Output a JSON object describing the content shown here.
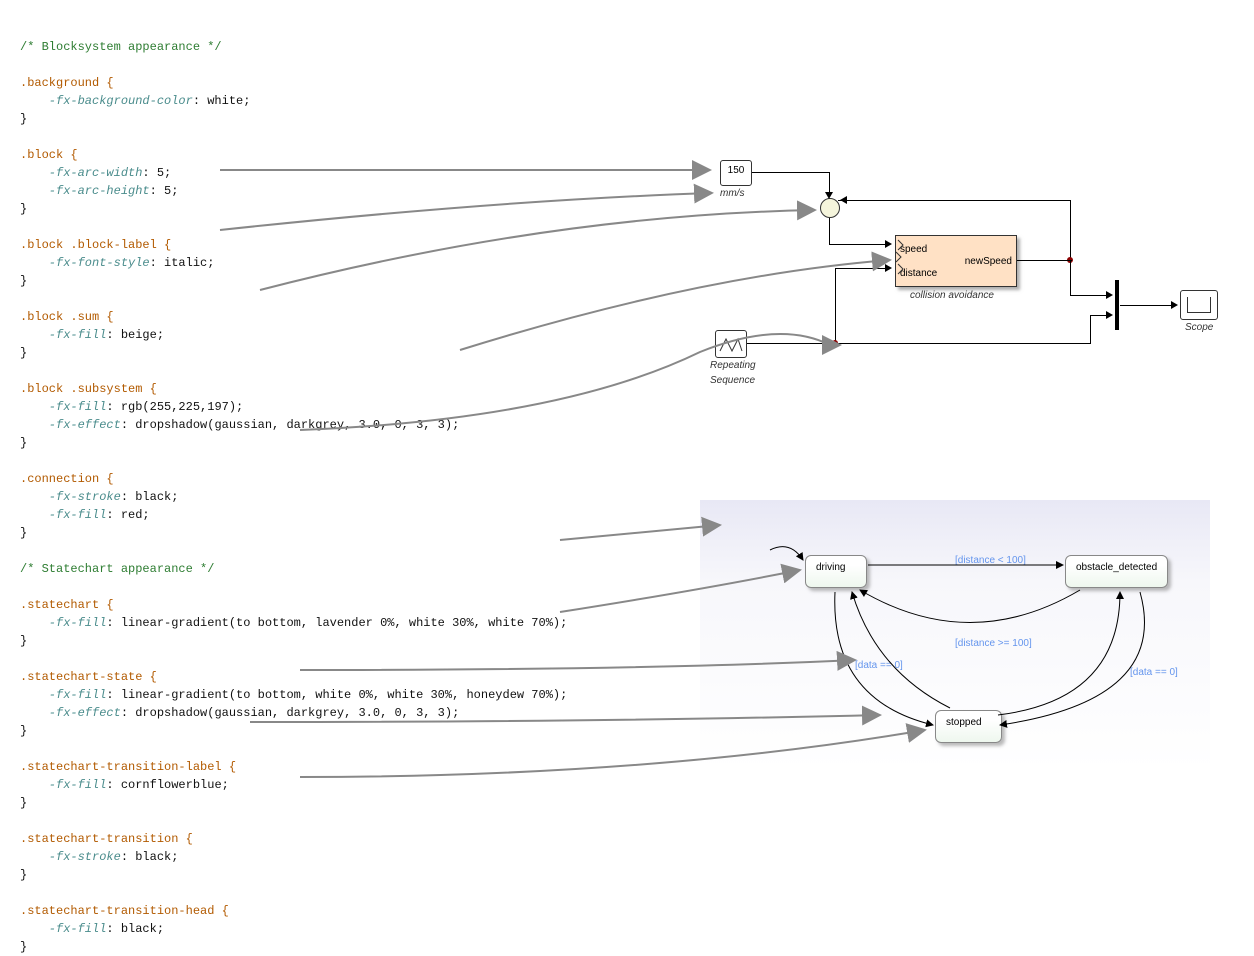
{
  "code": {
    "comment_block": "/* Blocksystem appearance */",
    "background_sel": ".background {",
    "background_p1": "    -fx-background-color",
    "background_v1": ": white;",
    "block_sel": ".block {",
    "block_p1": "    -fx-arc-width",
    "block_v1": ": 5;",
    "block_p2": "    -fx-arc-height",
    "block_v2": ": 5;",
    "blocklabel_sel": ".block .block-label {",
    "blocklabel_p1": "    -fx-font-style",
    "blocklabel_v1": ": italic;",
    "blocksum_sel": ".block .sum {",
    "blocksum_p1": "    -fx-fill",
    "blocksum_v1": ": beige;",
    "blocksub_sel": ".block .subsystem {",
    "blocksub_p1": "    -fx-fill",
    "blocksub_v1": ": rgb(255,225,197);",
    "blocksub_p2": "    -fx-effect",
    "blocksub_v2": ": dropshadow(gaussian, darkgrey, 3.0, 0, 3, 3);",
    "conn_sel": ".connection {",
    "conn_p1": "    -fx-stroke",
    "conn_v1": ": black;",
    "conn_p2": "    -fx-fill",
    "conn_v2": ": red;",
    "comment_state": "/* Statechart appearance */",
    "sc_sel": ".statechart {",
    "sc_p1": "    -fx-fill",
    "sc_v1": ": linear-gradient(to bottom, lavender 0%, white 30%, white 70%);",
    "scstate_sel": ".statechart-state {",
    "scstate_p1": "    -fx-fill",
    "scstate_v1": ": linear-gradient(to bottom, white 0%, white 30%, honeydew 70%);",
    "scstate_p2": "    -fx-effect",
    "scstate_v2": ": dropshadow(gaussian, darkgrey, 3.0, 0, 3, 3);",
    "sctl_sel": ".statechart-transition-label {",
    "sctl_p1": "    -fx-fill",
    "sctl_v1": ": cornflowerblue;",
    "sct_sel": ".statechart-transition {",
    "sct_p1": "    -fx-stroke",
    "sct_v1": ": black;",
    "scth_sel": ".statechart-transition-head {",
    "scth_p1": "    -fx-fill",
    "scth_v1": ": black;",
    "close": "}"
  },
  "blocksystem": {
    "const_value": "150",
    "const_unit": "mm/s",
    "repseq_label1": "Repeating",
    "repseq_label2": "Sequence",
    "sub_port_in1": "speed",
    "sub_port_in2": "distance",
    "sub_port_out": "newSpeed",
    "sub_label": "collision avoidance",
    "scope_label": "Scope"
  },
  "statechart": {
    "state_driving": "driving",
    "state_obstacle": "obstacle_detected",
    "state_stopped": "stopped",
    "t_dist_lt": "[distance < 100]",
    "t_dist_ge": "[distance >= 100]",
    "t_data0_left": "[data == 0]",
    "t_data0_right": "[data == 0]"
  }
}
